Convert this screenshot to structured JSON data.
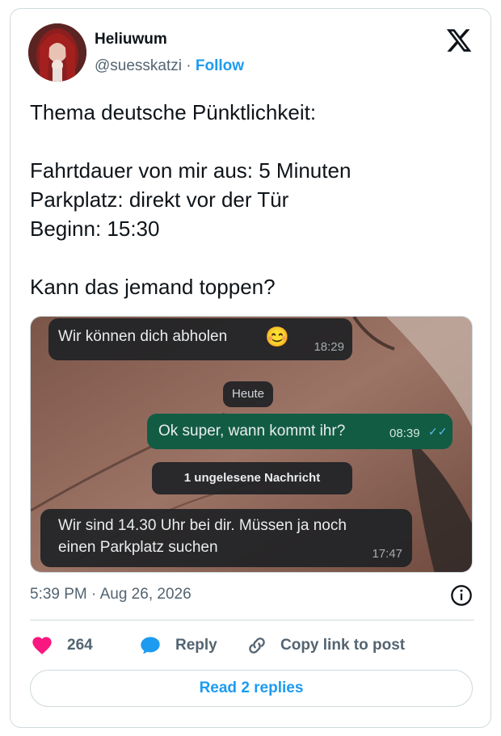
{
  "author": {
    "name": "Heliuwum",
    "handle": "@suesskatzi",
    "separator": "·",
    "follow_label": "Follow"
  },
  "tweet": {
    "lines": [
      "Thema deutsche Pünktlichkeit:",
      "",
      "Fahrtdauer von mir aus: 5 Minuten",
      "Parkplatz: direkt vor der Tür",
      "Beginn: 15:30",
      "",
      "Kann das jemand toppen?"
    ]
  },
  "chat": {
    "msg1": {
      "text": "Wir können dich abholen",
      "emoji": "😊",
      "time": "18:29"
    },
    "date_pill": "Heute",
    "msg2": {
      "text": "Ok super, wann kommt ihr?",
      "time": "08:39",
      "ticks": "✓✓"
    },
    "unread_pill": "1 ungelesene Nachricht",
    "msg3": {
      "line1": "Wir sind 14.30 Uhr bei dir. Müssen ja noch",
      "line2": "einen Parkplatz suchen",
      "time": "17:47"
    }
  },
  "meta": {
    "timestamp": "5:39 PM · Aug 26, 2026"
  },
  "actions": {
    "likes": "264",
    "reply_label": "Reply",
    "copy_label": "Copy link to post"
  },
  "read_replies_label": "Read 2 replies",
  "icons": [
    "avatar",
    "x-logo-icon",
    "info-icon",
    "heart-icon",
    "reply-icon",
    "link-icon"
  ],
  "colors": {
    "accent": "#1d9bf0",
    "heart": "#f91880",
    "text": "#0f1419",
    "muted": "#536471",
    "outgoing_bubble": "#135c44"
  }
}
